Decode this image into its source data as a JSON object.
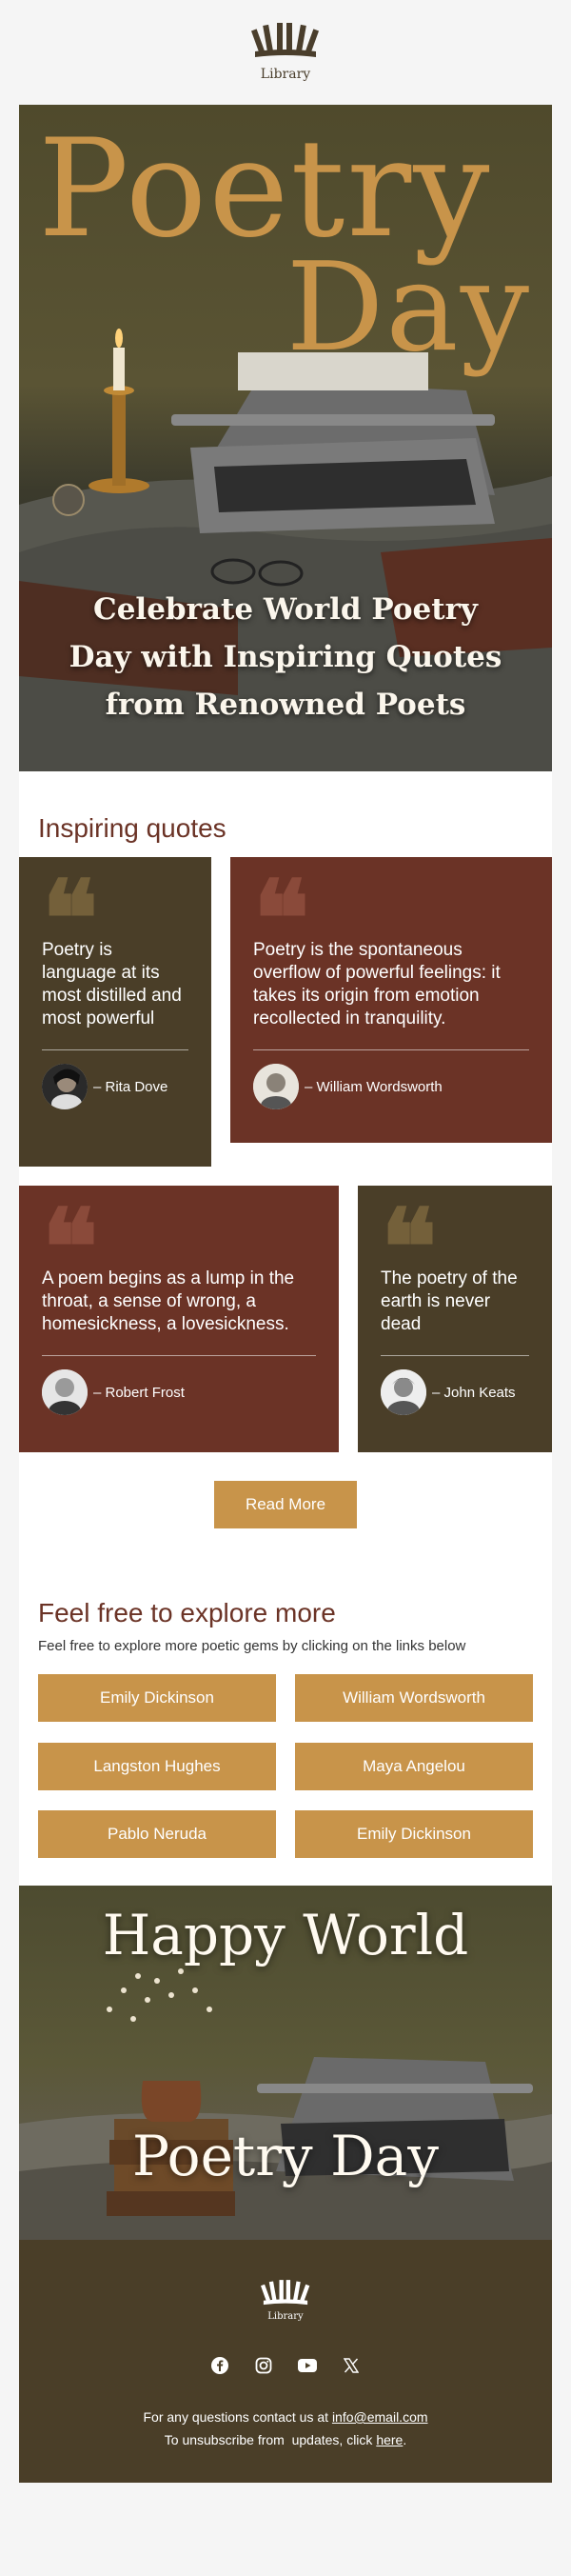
{
  "brand": {
    "logo_text": "Library"
  },
  "hero": {
    "title_line1": "Poetry",
    "title_line2": "Day",
    "subtitle_line1": "Celebrate World Poetry",
    "subtitle_line2": "Day with Inspiring Quotes",
    "subtitle_line3": "from Renowned Poets"
  },
  "quotes_section": {
    "title": "Inspiring quotes",
    "quote_mark": "❝",
    "quotes": [
      {
        "text": "Poetry is language at its most distilled and most powerful",
        "author": "– Rita Dove"
      },
      {
        "text": "Poetry is the spontaneous overflow of powerful feelings: it takes its origin from emotion recollected in tranquility.",
        "author": "– William Wordsworth"
      },
      {
        "text": "A poem begins as a lump in the throat, a sense of wrong, a homesickness, a lovesickness.",
        "author": "– Robert Frost"
      },
      {
        "text": "The poetry of the earth is never dead",
        "author": "– John Keats"
      }
    ],
    "read_more_label": "Read More"
  },
  "explore": {
    "title": "Feel free to explore more",
    "subtitle": "Feel free to explore more poetic gems by clicking on the links below",
    "links": [
      "Emily Dickinson",
      "William Wordsworth",
      "Langston Hughes",
      "Maya Angelou",
      "Pablo Neruda",
      "Emily Dickinson"
    ]
  },
  "closing_banner": {
    "line1": "Happy World",
    "line2": "Poetry Day"
  },
  "footer": {
    "logo_text": "Library",
    "social_icons": [
      "facebook-icon",
      "instagram-icon",
      "youtube-icon",
      "x-icon"
    ],
    "contact_prefix": "For any questions contact us at ",
    "contact_email": "info@email.com",
    "unsubscribe_prefix": "To unsubscribe from  updates, click ",
    "unsubscribe_link": "here",
    "unsubscribe_suffix": "."
  },
  "colors": {
    "gold": "#c8944a",
    "olive": "#4a3e28",
    "maroon": "#6b3326",
    "page_bg": "#f5f5f5"
  }
}
